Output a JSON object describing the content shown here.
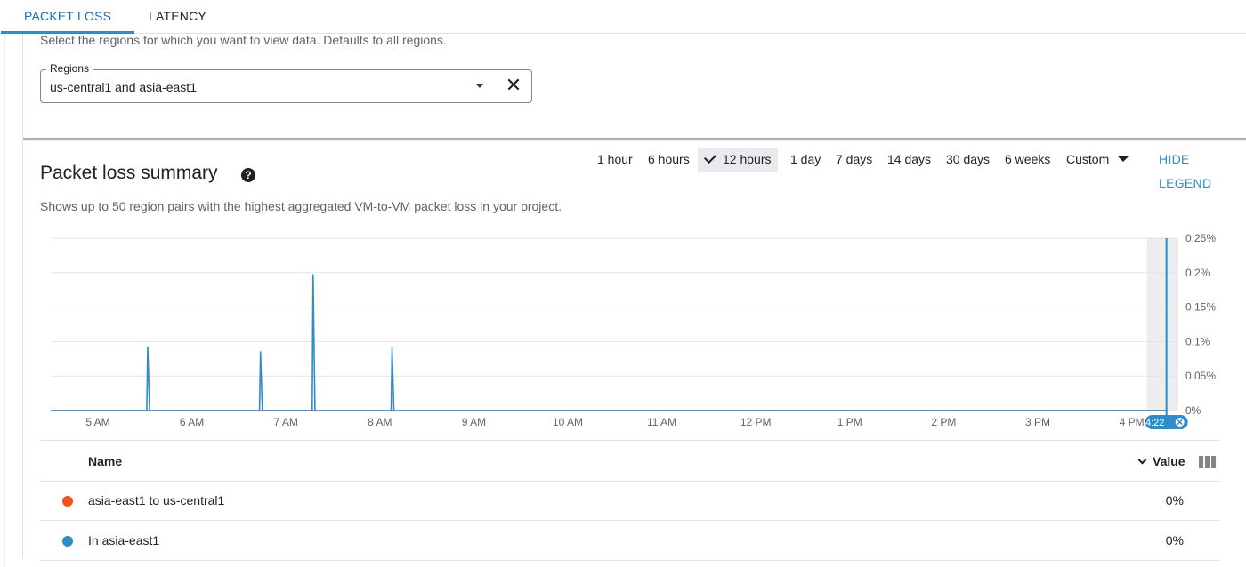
{
  "tabs": [
    {
      "label": "PACKET LOSS",
      "active": true
    },
    {
      "label": "LATENCY",
      "active": false
    }
  ],
  "regions_hint": "Select the regions for which you want to view data. Defaults to all regions.",
  "regions_field": {
    "label": "Regions",
    "value": "us-central1 and asia-east1"
  },
  "summary": {
    "title": "Packet loss summary",
    "subtitle": "Shows up to 50 region pairs with the highest aggregated VM-to-VM packet loss in your project."
  },
  "time_ranges": [
    "1 hour",
    "6 hours",
    "12 hours",
    "1 day",
    "7 days",
    "14 days",
    "30 days",
    "6 weeks",
    "Custom"
  ],
  "selected_range": "12 hours",
  "hide_legend_label": "HIDE LEGEND",
  "colors": {
    "accent": "#2f8bc9",
    "series_blue": "#2f8bc9",
    "series_orange": "#f4511e"
  },
  "chart_data": {
    "type": "line",
    "x_tick_labels": [
      "5 AM",
      "6 AM",
      "7 AM",
      "8 AM",
      "9 AM",
      "10 AM",
      "11 AM",
      "12 PM",
      "1 PM",
      "2 PM",
      "3 PM",
      "4 PM"
    ],
    "y_tick_labels": [
      "0%",
      "0.05%",
      "0.1%",
      "0.15%",
      "0.2%",
      "0.25%"
    ],
    "ylim": [
      0,
      0.25
    ],
    "x_range_hours": [
      4.5,
      16.4
    ],
    "cursor_label": "4:22",
    "cursor_time": 16.37,
    "series": [
      {
        "color": "#2f8bc9",
        "points": [
          [
            4.5,
            0
          ],
          [
            5.52,
            0
          ],
          [
            5.53,
            0.092
          ],
          [
            5.55,
            0
          ],
          [
            6.72,
            0
          ],
          [
            6.73,
            0.085
          ],
          [
            6.75,
            0
          ],
          [
            7.28,
            0
          ],
          [
            7.29,
            0.197
          ],
          [
            7.31,
            0
          ],
          [
            8.12,
            0
          ],
          [
            8.13,
            0.091
          ],
          [
            8.15,
            0
          ],
          [
            16.37,
            0
          ]
        ]
      },
      {
        "color": "#f4511e",
        "points": [
          [
            4.5,
            0
          ],
          [
            16.37,
            0
          ]
        ]
      }
    ]
  },
  "table": {
    "col_name": "Name",
    "col_value": "Value",
    "rows": [
      {
        "name": "asia-east1 to us-central1",
        "value": "0%",
        "color": "#f4511e"
      },
      {
        "name": "In asia-east1",
        "value": "0%",
        "color": "#2f8bc9"
      }
    ]
  }
}
